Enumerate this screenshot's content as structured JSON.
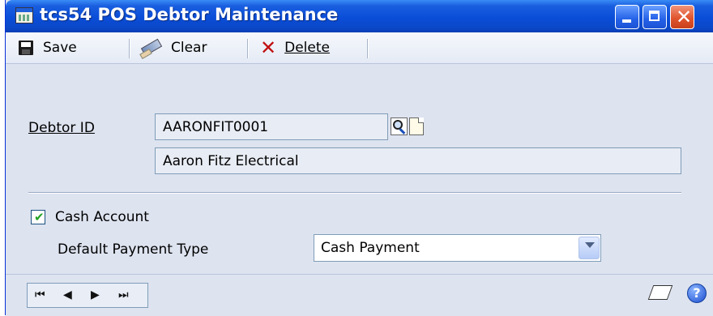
{
  "window": {
    "title": "tcs54 POS Debtor Maintenance",
    "titlebar_color": "#0a4dd8",
    "close_color": "#e0552e"
  },
  "toolbar": {
    "save_label": "Save",
    "clear_label": "Clear",
    "delete_label": "Delete"
  },
  "form": {
    "debtor_id_label": "Debtor ID",
    "debtor_id_value": "AARONFIT0001",
    "debtor_name_value": "Aaron Fitz Electrical",
    "cash_account_label": "Cash Account",
    "cash_account_checked": true,
    "default_payment_type_label": "Default Payment Type",
    "default_payment_type_value": "Cash Payment"
  },
  "navigation": {
    "first_glyph": "⏮",
    "prev_glyph": "◀",
    "next_glyph": "▶",
    "last_glyph": "⏭"
  },
  "icons": [
    "window-app-icon",
    "save-icon",
    "clear-icon",
    "delete-icon",
    "lookup-icon",
    "new-document-icon",
    "note-icon",
    "help-icon"
  ]
}
